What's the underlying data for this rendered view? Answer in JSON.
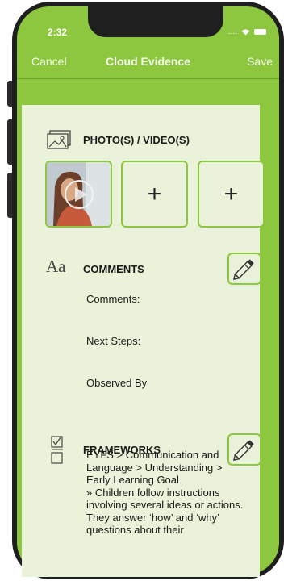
{
  "status": {
    "time": "2:32",
    "signal": "...."
  },
  "nav": {
    "cancel": "Cancel",
    "title": "Cloud Evidence",
    "save": "Save"
  },
  "photos": {
    "heading": "PHOTO(S) / VIDEO(S)",
    "add_label": "+"
  },
  "comments": {
    "icon_text": "Aa",
    "heading": "COMMENTS",
    "fields": [
      "Comments:",
      "Next Steps:",
      "Observed By"
    ]
  },
  "frameworks": {
    "heading": "FRAMEWORKS",
    "lines": [
      "EYFS > Communication and",
      "Language > Understanding >",
      "Early Learning Goal",
      "» Children follow instructions",
      "involving several ideas or actions.",
      "They answer ‘how’ and ‘why’",
      "questions about their"
    ]
  },
  "colors": {
    "accent": "#8dc63f",
    "card": "#eaf3d9",
    "frame": "#1f1f1f"
  }
}
